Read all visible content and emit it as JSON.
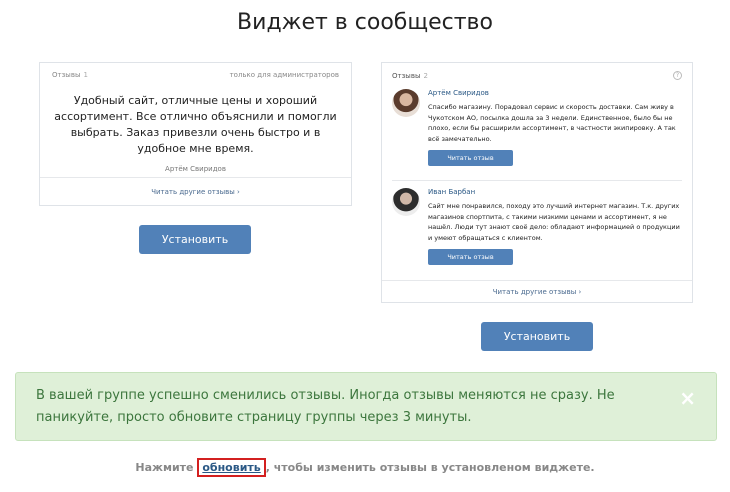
{
  "page": {
    "title": "Виджет в сообщество"
  },
  "widget1": {
    "header_label": "Отзывы",
    "header_count": "1",
    "admin_note": "только для администраторов",
    "review_text": "Удобный сайт, отличные цены и хороший ассортимент. Все отлично объяснили и помогли выбрать. Заказ привезли очень быстро и в удобное мне время.",
    "author": "Артём Свиридов",
    "footer_link": "Читать другие отзывы ›",
    "install_label": "Установить"
  },
  "widget2": {
    "header_label": "Отзывы",
    "header_count": "2",
    "help_icon": "?",
    "reviews": [
      {
        "name": "Артём Свиридов",
        "text": "Спасибо магазину. Порадовал сервис и скорость доставки. Сам живу в Чукотском АО, посылка дошла за 3 недели. Единственное, было бы не плохо, если бы расширили ассортимент, в частности экипировку. А так всё замечательно.",
        "button": "Читать отзыв"
      },
      {
        "name": "Иван Барбан",
        "text": "Сайт мне понравился, походу это лучший интернет магазин. Т.к. других магазинов спортпита, с такими низкими ценами и ассортимент, я не нашёл. Люди тут знают своё дело: обладают информацией о продукции и умеют обращаться с клиентом.",
        "button": "Читать отзыв"
      }
    ],
    "footer_link": "Читать другие отзывы ›",
    "install_label": "Установить"
  },
  "alert": {
    "text": "В вашей группе успешно сменились отзывы. Иногда отзывы меняются не сразу. Не паникуйте, просто обновите страницу группы через 3 минуты.",
    "close": "×"
  },
  "hint": {
    "before": "Нажмите ",
    "link": "обновить",
    "after": ", чтобы изменить отзывы в установленом виджете."
  }
}
